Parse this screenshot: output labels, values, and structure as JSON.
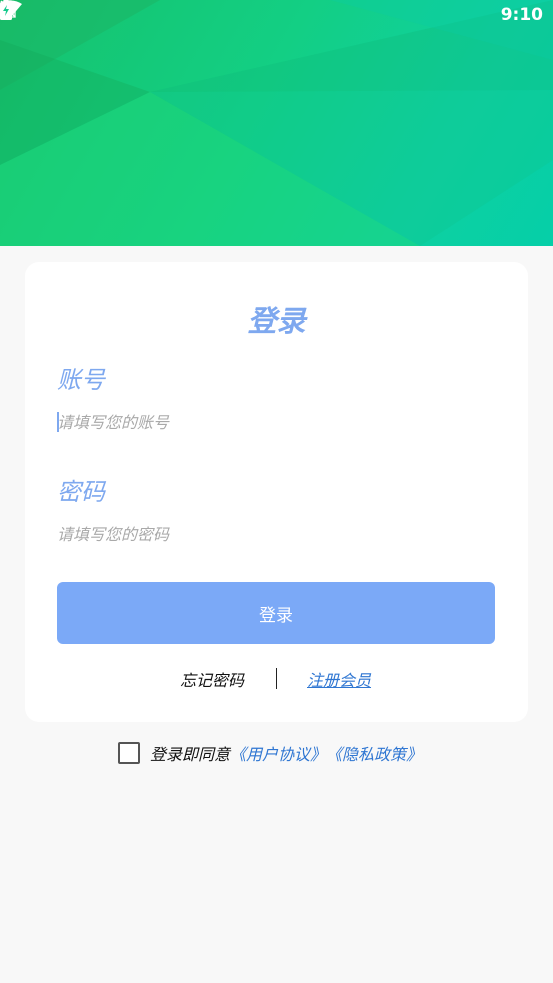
{
  "status_bar": {
    "time": "9:10",
    "icons": [
      "wifi-icon",
      "no-sim-icon",
      "battery-charging-icon"
    ]
  },
  "colors": {
    "header_green": "#16c26c",
    "header_teal": "#05cfa8",
    "accent_blue": "#7ea8ef",
    "button_blue": "#7ba9f7",
    "link_blue": "#2f76d2"
  },
  "login_card": {
    "title": "登录",
    "account": {
      "label": "账号",
      "placeholder": "请填写您的账号",
      "value": ""
    },
    "password": {
      "label": "密码",
      "placeholder": "请填写您的密码",
      "value": ""
    },
    "login_button": "登录",
    "forgot_password": "忘记密码",
    "register": "注册会员"
  },
  "agreement": {
    "checked": false,
    "prefix": "登录即同意",
    "user_agreement": "《用户协议》",
    "privacy_policy": "《隐私政策》"
  }
}
